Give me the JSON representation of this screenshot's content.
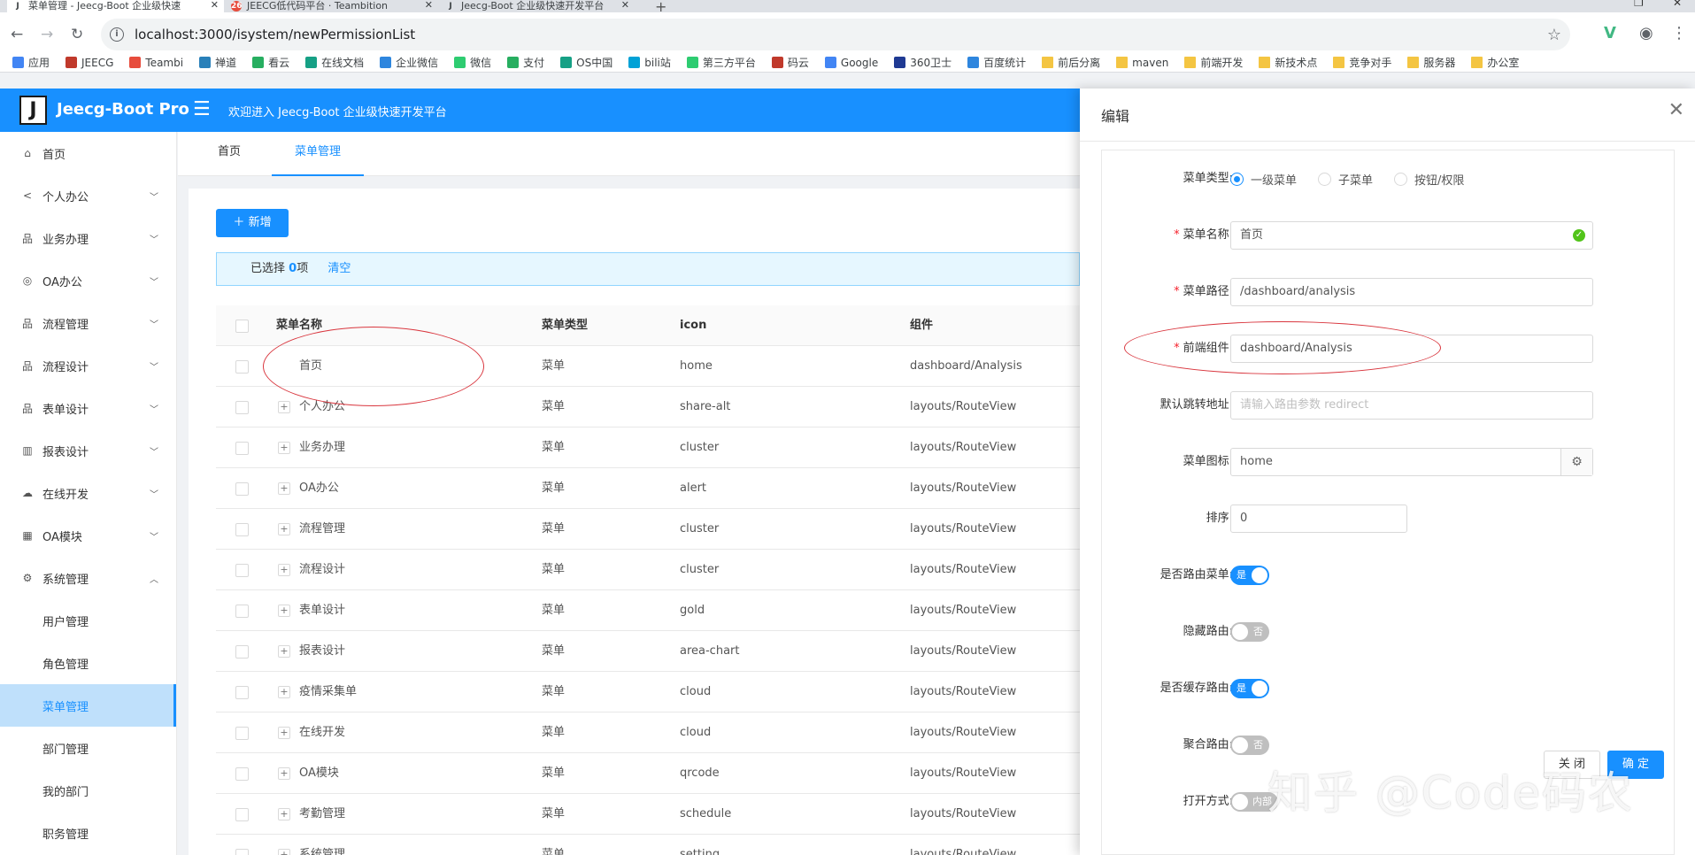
{
  "browser": {
    "tabs": [
      {
        "title": "菜单管理 - Jeecg-Boot 企业级快速",
        "favicon": "J"
      },
      {
        "title": "JEECG低代码平台 · Teambition",
        "favicon": "26"
      },
      {
        "title": "Jeecg-Boot 企业级快速开发平台",
        "favicon": "J"
      }
    ],
    "new_tab": "+",
    "url": "localhost:3000/isystem/newPermissionList",
    "bookmarks": [
      {
        "label": "应用",
        "color": "#4285f4"
      },
      {
        "label": "JEECG",
        "color": "#c0392b"
      },
      {
        "label": "Teambi",
        "color": "#e74c3c"
      },
      {
        "label": "禅道",
        "color": "#2980b9"
      },
      {
        "label": "看云",
        "color": "#27ae60"
      },
      {
        "label": "在线文档",
        "color": "#16a085"
      },
      {
        "label": "企业微信",
        "color": "#2e86de"
      },
      {
        "label": "微信",
        "color": "#2ecc71"
      },
      {
        "label": "支付",
        "color": "#27ae60"
      },
      {
        "label": "OS中国",
        "color": "#16a085"
      },
      {
        "label": "bili站",
        "color": "#00a1d6"
      },
      {
        "label": "第三方平台",
        "color": "#2ecc71"
      },
      {
        "label": "码云",
        "color": "#c0392b"
      },
      {
        "label": "Google",
        "color": "#4285f4"
      },
      {
        "label": "360卫士",
        "color": "#1f3a93"
      },
      {
        "label": "百度统计",
        "color": "#2e86de"
      },
      {
        "label": "前后分离",
        "color": "#f4c542"
      },
      {
        "label": "maven",
        "color": "#f4c542"
      },
      {
        "label": "前端开发",
        "color": "#f4c542"
      },
      {
        "label": "新技术点",
        "color": "#f4c542"
      },
      {
        "label": "竞争对手",
        "color": "#f4c542"
      },
      {
        "label": "服务器",
        "color": "#f4c542"
      },
      {
        "label": "办公室",
        "color": "#f4c542"
      }
    ]
  },
  "header": {
    "logo": "J",
    "title": "Jeecg-Boot Pro",
    "welcome": "欢迎进入 Jeecg-Boot 企业级快速开发平台"
  },
  "sidebar": {
    "items": [
      {
        "label": "首页",
        "icon": "home-icon",
        "glyph": "⌂"
      },
      {
        "label": "个人办公",
        "icon": "share-icon",
        "glyph": "<"
      },
      {
        "label": "业务办理",
        "icon": "cluster-icon",
        "glyph": "品"
      },
      {
        "label": "OA办公",
        "icon": "alert-icon",
        "glyph": "◎"
      },
      {
        "label": "流程管理",
        "icon": "cluster-icon",
        "glyph": "品"
      },
      {
        "label": "流程设计",
        "icon": "cluster-icon",
        "glyph": "品"
      },
      {
        "label": "表单设计",
        "icon": "gold-icon",
        "glyph": "品"
      },
      {
        "label": "报表设计",
        "icon": "area-chart-icon",
        "glyph": "▥"
      },
      {
        "label": "在线开发",
        "icon": "cloud-icon",
        "glyph": "☁"
      },
      {
        "label": "OA模块",
        "icon": "qrcode-icon",
        "glyph": "▦"
      },
      {
        "label": "系统管理",
        "icon": "setting-icon",
        "glyph": "⚙"
      }
    ],
    "subitems": [
      "用户管理",
      "角色管理",
      "菜单管理",
      "部门管理",
      "我的部门",
      "职务管理"
    ]
  },
  "page_tabs": [
    "首页",
    "菜单管理"
  ],
  "toolbar": {
    "add_label": "新增"
  },
  "selection": {
    "prefix": "已选择 ",
    "count": "0",
    "suffix": "项",
    "clear": "清空"
  },
  "table": {
    "columns": [
      "菜单名称",
      "菜单类型",
      "icon",
      "组件"
    ],
    "rows": [
      {
        "name": "首页",
        "type": "菜单",
        "icon": "home",
        "component": "dashboard/Analysis"
      },
      {
        "name": "个人办公",
        "type": "菜单",
        "icon": "share-alt",
        "component": "layouts/RouteView"
      },
      {
        "name": "业务办理",
        "type": "菜单",
        "icon": "cluster",
        "component": "layouts/RouteView"
      },
      {
        "name": "OA办公",
        "type": "菜单",
        "icon": "alert",
        "component": "layouts/RouteView"
      },
      {
        "name": "流程管理",
        "type": "菜单",
        "icon": "cluster",
        "component": "layouts/RouteView"
      },
      {
        "name": "流程设计",
        "type": "菜单",
        "icon": "cluster",
        "component": "layouts/RouteView"
      },
      {
        "name": "表单设计",
        "type": "菜单",
        "icon": "gold",
        "component": "layouts/RouteView"
      },
      {
        "name": "报表设计",
        "type": "菜单",
        "icon": "area-chart",
        "component": "layouts/RouteView"
      },
      {
        "name": "疫情采集单",
        "type": "菜单",
        "icon": "cloud",
        "component": "layouts/RouteView"
      },
      {
        "name": "在线开发",
        "type": "菜单",
        "icon": "cloud",
        "component": "layouts/RouteView"
      },
      {
        "name": "OA模块",
        "type": "菜单",
        "icon": "qrcode",
        "component": "layouts/RouteView"
      },
      {
        "name": "考勤管理",
        "type": "菜单",
        "icon": "schedule",
        "component": "layouts/RouteView"
      },
      {
        "name": "系统管理",
        "type": "菜单",
        "icon": "setting",
        "component": "layouts/RouteView"
      }
    ]
  },
  "drawer": {
    "title": "编辑",
    "menu_type": {
      "label": "菜单类型:",
      "options": [
        "一级菜单",
        "子菜单",
        "按钮/权限"
      ],
      "selected": 0
    },
    "menu_name": {
      "label": "菜单名称:",
      "value": "首页"
    },
    "menu_path": {
      "label": "菜单路径:",
      "value": "/dashboard/analysis"
    },
    "component": {
      "label": "前端组件:",
      "value": "dashboard/Analysis"
    },
    "redirect": {
      "label": "默认跳转地址:",
      "placeholder": "请输入路由参数 redirect"
    },
    "menu_icon": {
      "label": "菜单图标:",
      "value": "home"
    },
    "sort": {
      "label": "排序:",
      "value": "0"
    },
    "is_route": {
      "label": "是否路由菜单:",
      "on": true,
      "text": "是"
    },
    "hidden": {
      "label": "隐藏路由:",
      "on": false,
      "text": "否"
    },
    "keep_alive": {
      "label": "是否缓存路由:",
      "on": true,
      "text": "是"
    },
    "always_show": {
      "label": "聚合路由:",
      "on": false,
      "text": "否"
    },
    "open_type": {
      "label": "打开方式:",
      "on": false,
      "text": "内部"
    },
    "close_label": "关 闭",
    "ok_label": "确 定"
  },
  "watermark": "知乎 @Code码农",
  "colors": {
    "primary": "#1890ff",
    "annotation": "#d9363e",
    "success": "#52c41a"
  }
}
